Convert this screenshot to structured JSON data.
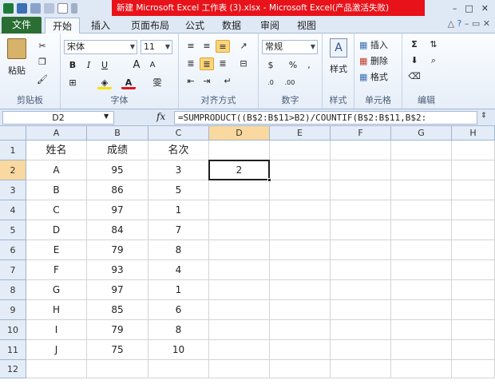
{
  "title_bar": {
    "title": "新建 Microsoft Excel 工作表 (3).xlsx  -  Microsoft Excel(产品激活失败)",
    "minimize": "–",
    "maximize": "□",
    "close": "✕"
  },
  "ribbon_tabs": {
    "file": "文件",
    "items": [
      "开始",
      "插入",
      "页面布局",
      "公式",
      "数据",
      "审阅",
      "视图"
    ],
    "active": "开始"
  },
  "ribbon": {
    "clipboard": {
      "paste": "粘贴",
      "label": "剪贴板"
    },
    "font": {
      "font_name": "宋体",
      "font_size": "11",
      "bold": "B",
      "italic": "I",
      "underline": "U",
      "grow": "A",
      "shrink": "A",
      "font_color": "A",
      "phonetic": "雯",
      "label": "字体"
    },
    "alignment": {
      "label": "对齐方式"
    },
    "number": {
      "format": "常规",
      "percent": "%",
      "comma": ",",
      "label": "数字"
    },
    "styles": {
      "styles": "样式",
      "label": "样式"
    },
    "cells": {
      "insert": "插入",
      "delete": "删除",
      "format": "格式",
      "label": "单元格"
    },
    "editing": {
      "sum": "Σ",
      "label": "编辑"
    }
  },
  "formula_bar": {
    "name_box": "D2",
    "fx": "fx",
    "formula": "=SUMPRODUCT((B$2:B$11>B2)/COUNTIF(B$2:B$11,B$2:"
  },
  "sheet": {
    "columns": [
      "A",
      "B",
      "C",
      "D",
      "E",
      "F",
      "G",
      "H"
    ],
    "selected_column": "D",
    "selected_row": "2",
    "rows": [
      {
        "num": "1",
        "A": "姓名",
        "B": "成绩",
        "C": "名次",
        "D": ""
      },
      {
        "num": "2",
        "A": "A",
        "B": "95",
        "C": "3",
        "D": "2"
      },
      {
        "num": "3",
        "A": "B",
        "B": "86",
        "C": "5",
        "D": ""
      },
      {
        "num": "4",
        "A": "C",
        "B": "97",
        "C": "1",
        "D": ""
      },
      {
        "num": "5",
        "A": "D",
        "B": "84",
        "C": "7",
        "D": ""
      },
      {
        "num": "6",
        "A": "E",
        "B": "79",
        "C": "8",
        "D": ""
      },
      {
        "num": "7",
        "A": "F",
        "B": "93",
        "C": "4",
        "D": ""
      },
      {
        "num": "8",
        "A": "G",
        "B": "97",
        "C": "1",
        "D": ""
      },
      {
        "num": "9",
        "A": "H",
        "B": "85",
        "C": "6",
        "D": ""
      },
      {
        "num": "10",
        "A": "I",
        "B": "79",
        "C": "8",
        "D": ""
      },
      {
        "num": "11",
        "A": "J",
        "B": "75",
        "C": "10",
        "D": ""
      },
      {
        "num": "12",
        "A": "",
        "B": "",
        "C": "",
        "D": ""
      }
    ]
  }
}
